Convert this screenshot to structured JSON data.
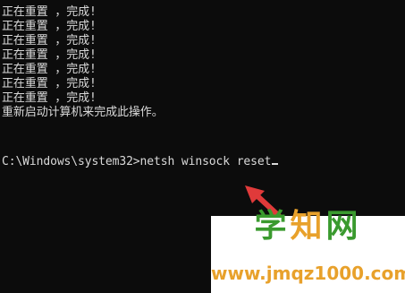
{
  "console": {
    "lines": [
      "正在重置 ，完成!",
      "正在重置 ，完成!",
      "正在重置 ，完成!",
      "正在重置 ，完成!",
      "正在重置 ，完成!",
      "正在重置 ，完成!",
      "正在重置 ，完成!",
      "重新启动计算机来完成此操作。"
    ],
    "prompt": "C:\\Windows\\system32>netsh winsock reset"
  },
  "annotation": {
    "arrow_color": "#e03a3a"
  },
  "watermark": {
    "title": "学知网",
    "url": "www.jmqz1000.com",
    "title_colors": [
      "#3a9a2e",
      "#e8a12b",
      "#3a9a2e"
    ]
  },
  "colors": {
    "background": "#0c0c0c",
    "text": "#d9d9d9"
  }
}
